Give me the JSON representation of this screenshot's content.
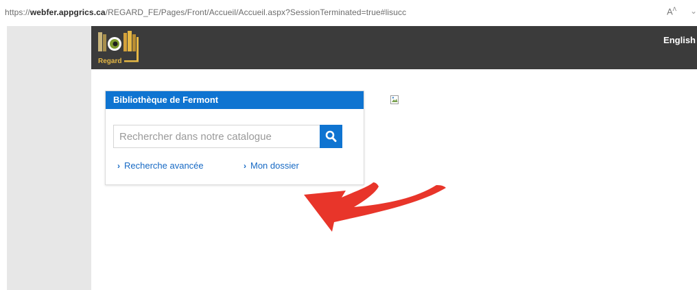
{
  "browser": {
    "url_prefix": "https://",
    "url_host": "webfer.appgrics.ca",
    "url_path": "/REGARD_FE/Pages/Front/Accueil/Accueil.aspx?SessionTerminated=true#lisucc",
    "read_aloud_label": "A",
    "read_aloud_sup": "Ʌ"
  },
  "header": {
    "logo_text": "Regard",
    "language_link": "English"
  },
  "search_panel": {
    "title": "Bibliothèque de Fermont",
    "placeholder": "Rechercher dans notre catalogue",
    "value": "",
    "links": [
      {
        "label": "Recherche avancée"
      },
      {
        "label": "Mon dossier"
      }
    ]
  },
  "icons": {
    "search": "magnifier-icon",
    "link_chevron": "chevron-right-icon",
    "broken_image": "broken-image-icon",
    "annotation": "red-curved-arrow-icon"
  },
  "colors": {
    "header_bg": "#3b3b3b",
    "accent_blue": "#0f74d1",
    "link_blue": "#1669c4",
    "arrow_red": "#e8352a",
    "gutter_gray": "#e7e7e7"
  }
}
